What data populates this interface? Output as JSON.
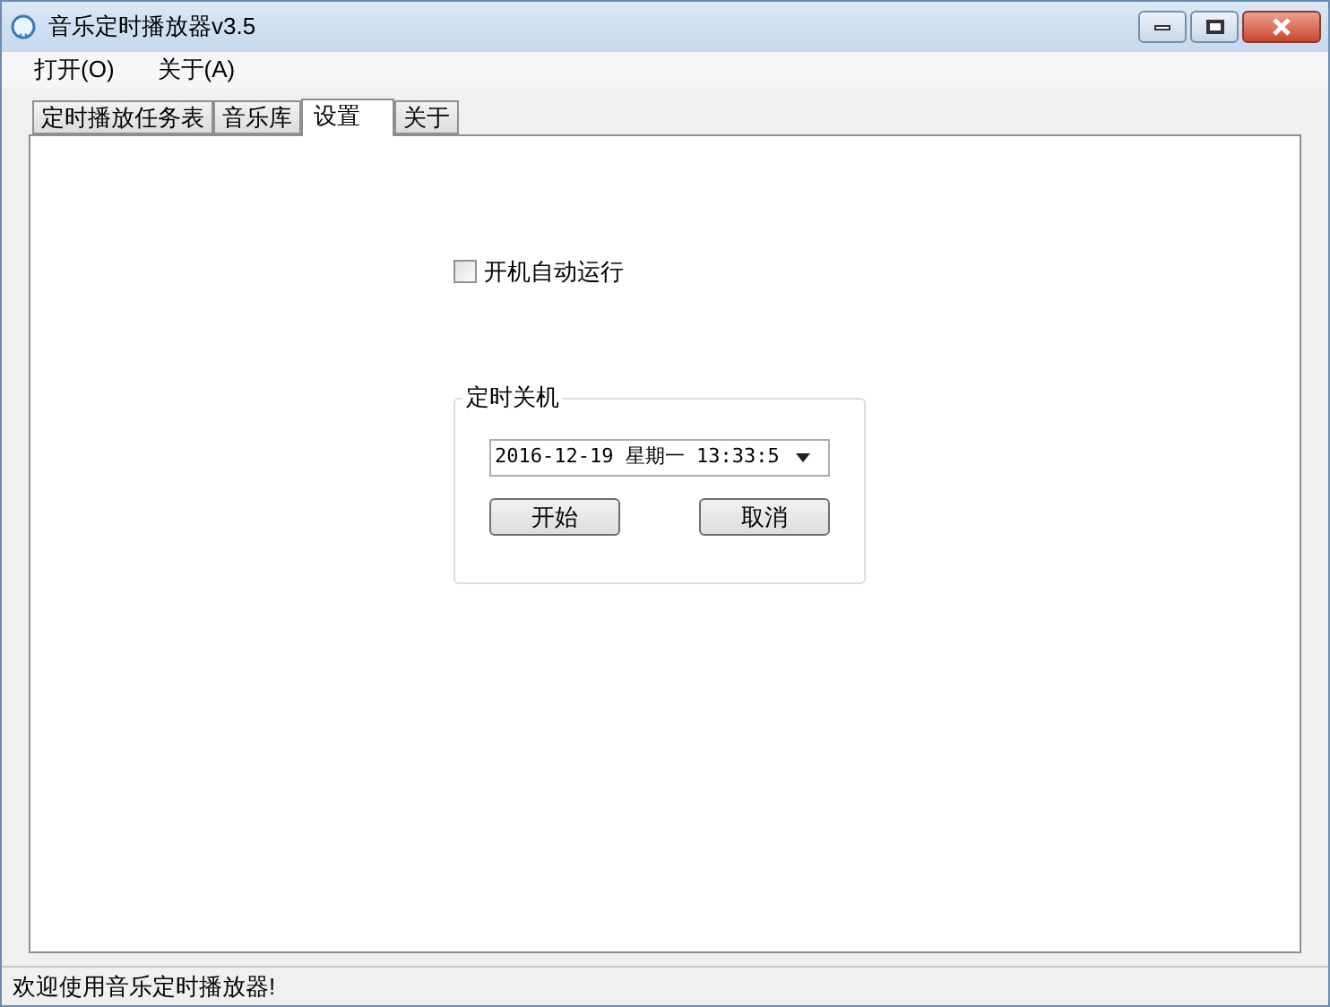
{
  "window": {
    "title": "音乐定时播放器v3.5"
  },
  "menu": [
    "打开(O)",
    "关于(A)"
  ],
  "tabs": [
    {
      "label": "定时播放任务表",
      "selected": false
    },
    {
      "label": "音乐库",
      "selected": false
    },
    {
      "label": "设置",
      "selected": true
    },
    {
      "label": "关于",
      "selected": false
    }
  ],
  "autostart": {
    "label": "开机自动运行",
    "checked": false
  },
  "shutdown": {
    "title": "定时关机",
    "datetime": "2016-12-19 星期一 13:33:5",
    "buttons": [
      "开始",
      "取消"
    ]
  },
  "status_bar": "欢迎使用音乐定时播放器!"
}
